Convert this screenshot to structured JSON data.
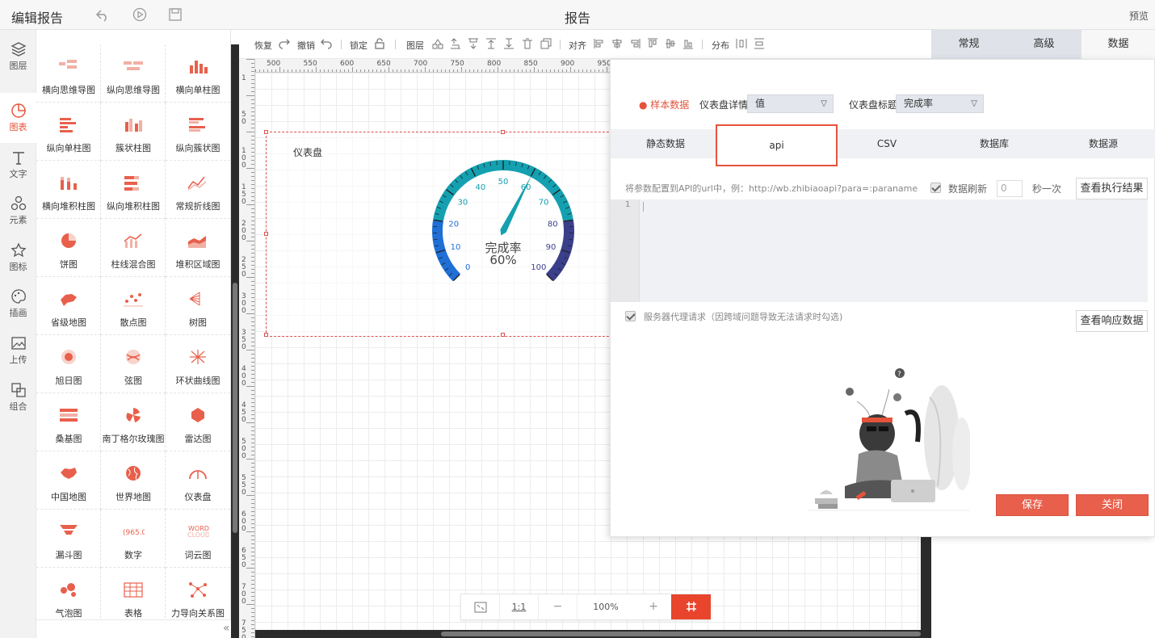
{
  "topbar": {
    "title": "编辑报告",
    "center_title": "报告",
    "preview": "预览"
  },
  "rail": [
    {
      "label": "图层",
      "icon": "layers-icon"
    },
    {
      "label": "图表",
      "icon": "chart-icon",
      "active": true
    },
    {
      "label": "文字",
      "icon": "text-icon"
    },
    {
      "label": "元素",
      "icon": "elements-icon"
    },
    {
      "label": "图标",
      "icon": "star-icon"
    },
    {
      "label": "插画",
      "icon": "palette-icon"
    },
    {
      "label": "上传",
      "icon": "upload-image-icon"
    },
    {
      "label": "组合",
      "icon": "group-icon"
    }
  ],
  "palette": [
    "横向思维导图",
    "纵向思维导图",
    "横向单柱图",
    "纵向单柱图",
    "簇状柱图",
    "纵向簇状图",
    "横向堆积柱图",
    "纵向堆积柱图",
    "常规折线图",
    "饼图",
    "柱线混合图",
    "堆积区域图",
    "省级地图",
    "散点图",
    "树图",
    "旭日图",
    "弦图",
    "环状曲线图",
    "桑基图",
    "南丁格尔玫瑰图",
    "雷达图",
    "中国地图",
    "世界地图",
    "仪表盘",
    "漏斗图",
    "数字",
    "词云图",
    "气泡图",
    "表格",
    "力导向关系图"
  ],
  "toolbar": {
    "redo": "恢复",
    "undo": "撤销",
    "lock": "锁定",
    "layer": "图层",
    "align": "对齐",
    "distribute": "分布"
  },
  "ruler": {
    "h_labels": [
      "500",
      "550",
      "600",
      "650",
      "700",
      "750",
      "800",
      "850",
      "900",
      "950"
    ],
    "v_labels": [
      "1",
      "50",
      "100",
      "150",
      "200",
      "250",
      "300",
      "350",
      "400",
      "450",
      "500",
      "550",
      "600",
      "650",
      "700",
      "750"
    ]
  },
  "widget": {
    "title": "仪表盘",
    "gauge_label": "完成率",
    "gauge_value_text": "60%",
    "gauge_value": 60,
    "gauge_min": 0,
    "gauge_max": 100,
    "ticks": [
      "0",
      "10",
      "20",
      "30",
      "40",
      "50",
      "60",
      "70",
      "80",
      "90",
      "100"
    ],
    "colors": {
      "low": "#1f6fd6",
      "mid": "#14a0b0",
      "high": "#3a3f8c"
    }
  },
  "zoombar": {
    "ratio": "1:1",
    "minus": "−",
    "zoom": "100%",
    "plus": "+"
  },
  "proptabs": [
    "常规",
    "高级",
    "数据"
  ],
  "dialog": {
    "sample_data": "样本数据",
    "detail_label": "仪表盘详情",
    "detail_value": "值",
    "title_label": "仪表盘标题",
    "title_value": "完成率",
    "source_tabs": [
      "静态数据",
      "api",
      "CSV",
      "数据库",
      "数据源"
    ],
    "api_hint": "将参数配置到API的url中，例：http://wb.zhibiaoapi?para=:paraname",
    "refresh_label": "数据刷新",
    "refresh_value": "0",
    "refresh_unit": "秒一次",
    "exec_button": "查看执行结果",
    "line_number": "1",
    "proxy_label": "服务器代理请求（因跨域问题导致无法请求时勾选)",
    "response_button": "查看响应数据",
    "save_button": "保存",
    "close_button": "关闭"
  }
}
